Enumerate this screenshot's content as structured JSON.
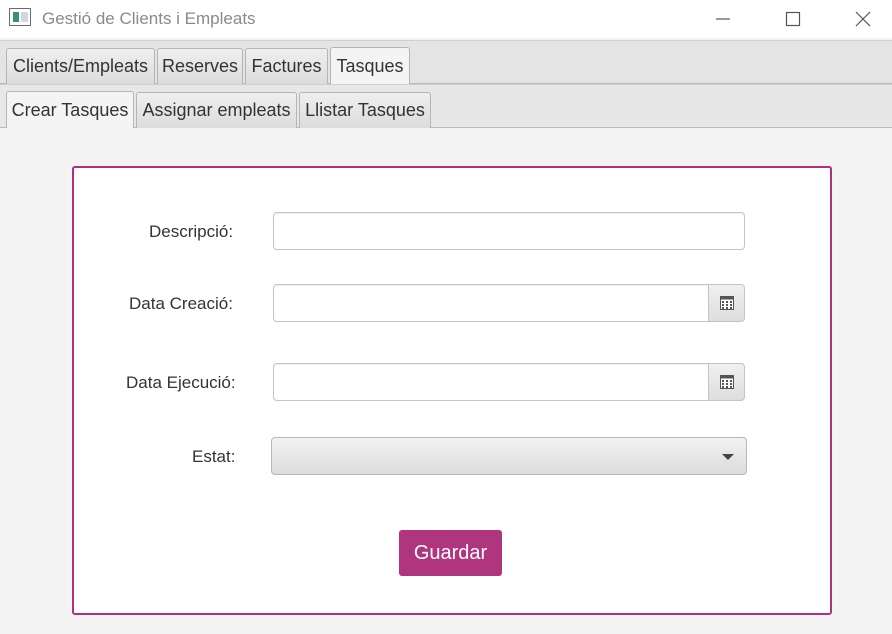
{
  "window": {
    "title": "Gestió de Clients i Empleats"
  },
  "main_tabs": [
    {
      "label": "Clients/Empleats"
    },
    {
      "label": "Reserves"
    },
    {
      "label": "Factures"
    },
    {
      "label": "Tasques",
      "selected": true
    }
  ],
  "sub_tabs": [
    {
      "label": "Crear Tasques",
      "selected": true
    },
    {
      "label": "Assignar empleats"
    },
    {
      "label": "Llistar Tasques"
    }
  ],
  "form": {
    "descripcio_label": "Descripció:",
    "descripcio_value": "",
    "data_creacio_label": "Data Creació:",
    "data_creacio_value": "",
    "data_ejecucio_label": "Data Ejecució:",
    "data_ejecucio_value": "",
    "estat_label": "Estat:",
    "estat_value": "",
    "save_label": "Guardar"
  },
  "colors": {
    "accent": "#b0357f",
    "card_border": "#b0307e"
  },
  "icons": {
    "calendar": "calendar-icon",
    "dropdown": "chevron-down-icon"
  }
}
